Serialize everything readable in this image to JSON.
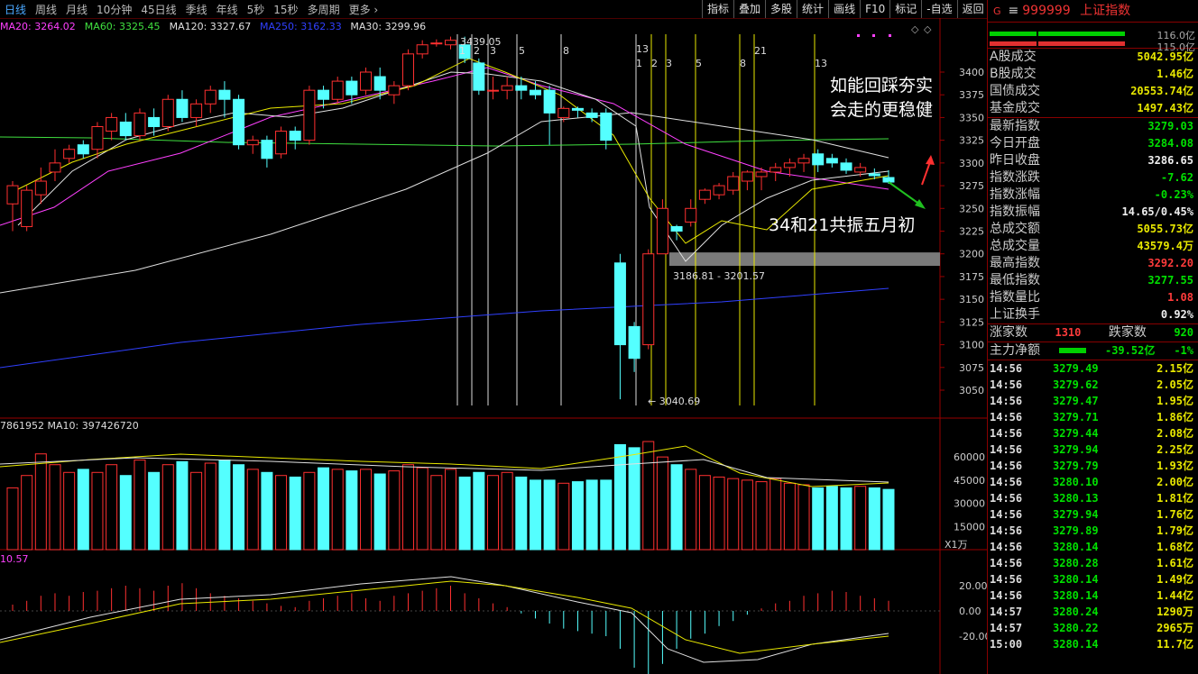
{
  "toolbar": {
    "periods": [
      "日线",
      "周线",
      "月线",
      "10分钟",
      "45日线",
      "季线",
      "年线",
      "5秒",
      "15秒",
      "多周期",
      "更多 ›"
    ],
    "tools": [
      "指标",
      "叠加",
      "多股",
      "统计",
      "画线",
      "F10",
      "标记",
      "-自选",
      "返回"
    ]
  },
  "ma_legend": [
    {
      "label": "MA20: 3264.02",
      "color": "#ff40ff"
    },
    {
      "label": "MA60: 3325.45",
      "color": "#40e040"
    },
    {
      "label": "MA120: 3327.67",
      "color": "#e0e0e0"
    },
    {
      "label": "MA250: 3162.33",
      "color": "#3040ff"
    },
    {
      "label": "MA30: 3299.96",
      "color": "#e0e0e0"
    }
  ],
  "price_axis": [
    "3400",
    "3375",
    "3350",
    "3325",
    "3300",
    "3275",
    "3250",
    "3225",
    "3200",
    "3175",
    "3150",
    "3125",
    "3100",
    "3075",
    "3050"
  ],
  "volume_axis": [
    "60000",
    "45000",
    "30000",
    "15000"
  ],
  "volume_unit": "X1万",
  "macd_axis": [
    "20.00",
    "0.00",
    "-20.00"
  ],
  "volume_legend": "7861952 MA10: 397426720",
  "macd_legend": "10.57",
  "annotations": {
    "high": "3439.05",
    "low": "3040.69",
    "gap_range": "3186.81 - 3201.57",
    "note1_line1": "如能回踩夯实",
    "note1_line2": "会走的更稳健",
    "note2": "34和21共振五月初",
    "fib_top": [
      "1",
      "2",
      "3",
      "5",
      "8"
    ],
    "fib_mid_top": [
      "13"
    ],
    "fib_mid": [
      "1",
      "2",
      "3",
      "5",
      "8"
    ],
    "fib_label_21": "21",
    "fib_label_13": "13"
  },
  "header": {
    "code": "999999",
    "name": "上证指数",
    "g": "G",
    "menu": "≡"
  },
  "bars_top": {
    "up": "116.0亿",
    "down": "115.0亿"
  },
  "stats": [
    {
      "label": "A股成交",
      "value": "5042.95亿",
      "color": "y"
    },
    {
      "label": "B股成交",
      "value": "1.46亿",
      "color": "y"
    },
    {
      "label": "国债成交",
      "value": "20553.74亿",
      "color": "y"
    },
    {
      "label": "基金成交",
      "value": "1497.43亿",
      "color": "y"
    }
  ],
  "stats2": [
    {
      "label": "最新指数",
      "value": "3279.03",
      "color": "gr"
    },
    {
      "label": "今日开盘",
      "value": "3284.08",
      "color": "gr"
    },
    {
      "label": "昨日收盘",
      "value": "3286.65",
      "color": "w"
    },
    {
      "label": "指数涨跌",
      "value": "-7.62",
      "color": "gr"
    },
    {
      "label": "指数涨幅",
      "value": "-0.23%",
      "color": "gr"
    },
    {
      "label": "指数振幅",
      "value": "14.65/0.45%",
      "color": "w"
    },
    {
      "label": "总成交额",
      "value": "5055.73亿",
      "color": "y"
    },
    {
      "label": "总成交量",
      "value": "43579.4万",
      "color": "y"
    },
    {
      "label": "最高指数",
      "value": "3292.20",
      "color": "r"
    },
    {
      "label": "最低指数",
      "value": "3277.55",
      "color": "gr"
    },
    {
      "label": "指数量比",
      "value": "1.08",
      "color": "r"
    },
    {
      "label": "上证换手",
      "value": "0.92%",
      "color": "w"
    }
  ],
  "updown": {
    "up_label": "涨家数",
    "up": "1310",
    "down_label": "跌家数",
    "down": "920"
  },
  "mainflow": {
    "label": "主力净额",
    "value": "-39.52亿",
    "pct": "-1%"
  },
  "ticks": [
    {
      "t": "14:56",
      "p": "3279.49",
      "v": "2.15亿"
    },
    {
      "t": "14:56",
      "p": "3279.62",
      "v": "2.05亿"
    },
    {
      "t": "14:56",
      "p": "3279.47",
      "v": "1.95亿"
    },
    {
      "t": "14:56",
      "p": "3279.71",
      "v": "1.86亿"
    },
    {
      "t": "14:56",
      "p": "3279.44",
      "v": "2.08亿"
    },
    {
      "t": "14:56",
      "p": "3279.94",
      "v": "2.25亿"
    },
    {
      "t": "14:56",
      "p": "3279.79",
      "v": "1.93亿"
    },
    {
      "t": "14:56",
      "p": "3280.10",
      "v": "2.00亿"
    },
    {
      "t": "14:56",
      "p": "3280.13",
      "v": "1.81亿"
    },
    {
      "t": "14:56",
      "p": "3279.94",
      "v": "1.76亿"
    },
    {
      "t": "14:56",
      "p": "3279.89",
      "v": "1.79亿"
    },
    {
      "t": "14:56",
      "p": "3280.14",
      "v": "1.68亿"
    },
    {
      "t": "14:56",
      "p": "3280.28",
      "v": "1.61亿"
    },
    {
      "t": "14:56",
      "p": "3280.14",
      "v": "1.49亿"
    },
    {
      "t": "14:56",
      "p": "3280.14",
      "v": "1.44亿"
    },
    {
      "t": "14:57",
      "p": "3280.24",
      "v": "1290万"
    },
    {
      "t": "14:57",
      "p": "3280.22",
      "v": "2965万"
    },
    {
      "t": "15:00",
      "p": "3280.14",
      "v": "11.7亿"
    }
  ],
  "chart_data": {
    "type": "candlestick",
    "y_range": [
      3040,
      3440
    ],
    "candles": [
      [
        3255,
        3275,
        3225,
        3280
      ],
      [
        3230,
        3270,
        3225,
        3275
      ],
      [
        3265,
        3280,
        3255,
        3295
      ],
      [
        3290,
        3300,
        3280,
        3315
      ],
      [
        3305,
        3315,
        3300,
        3320
      ],
      [
        3320,
        3310,
        3305,
        3325
      ],
      [
        3315,
        3340,
        3305,
        3345
      ],
      [
        3335,
        3350,
        3325,
        3355
      ],
      [
        3345,
        3330,
        3325,
        3355
      ],
      [
        3330,
        3355,
        3325,
        3360
      ],
      [
        3350,
        3340,
        3330,
        3360
      ],
      [
        3340,
        3370,
        3335,
        3375
      ],
      [
        3370,
        3350,
        3345,
        3380
      ],
      [
        3350,
        3365,
        3340,
        3370
      ],
      [
        3365,
        3380,
        3355,
        3385
      ],
      [
        3380,
        3370,
        3350,
        3390
      ],
      [
        3370,
        3320,
        3315,
        3375
      ],
      [
        3320,
        3325,
        3310,
        3330
      ],
      [
        3325,
        3305,
        3295,
        3330
      ],
      [
        3310,
        3335,
        3305,
        3340
      ],
      [
        3335,
        3325,
        3315,
        3340
      ],
      [
        3325,
        3380,
        3320,
        3385
      ],
      [
        3380,
        3370,
        3360,
        3385
      ],
      [
        3370,
        3390,
        3365,
        3395
      ],
      [
        3390,
        3375,
        3365,
        3395
      ],
      [
        3380,
        3400,
        3375,
        3405
      ],
      [
        3395,
        3380,
        3370,
        3405
      ],
      [
        3375,
        3385,
        3365,
        3390
      ],
      [
        3385,
        3420,
        3380,
        3425
      ],
      [
        3420,
        3430,
        3415,
        3435
      ],
      [
        3432,
        3432,
        3428,
        3436
      ],
      [
        3430,
        3435,
        3425,
        3439
      ],
      [
        3430,
        3415,
        3410,
        3439
      ],
      [
        3410,
        3380,
        3375,
        3415
      ],
      [
        3380,
        3380,
        3370,
        3395
      ],
      [
        3380,
        3385,
        3370,
        3395
      ],
      [
        3385,
        3380,
        3370,
        3395
      ],
      [
        3380,
        3375,
        3370,
        3390
      ],
      [
        3380,
        3355,
        3320,
        3385
      ],
      [
        3350,
        3360,
        3345,
        3362
      ],
      [
        3360,
        3358,
        3350,
        3362
      ],
      [
        3355,
        3350,
        3345,
        3360
      ],
      [
        3355,
        3325,
        3315,
        3360
      ],
      [
        3190,
        3100,
        3040,
        3200
      ],
      [
        3120,
        3085,
        3070,
        3125
      ],
      [
        3100,
        3200,
        3095,
        3205
      ],
      [
        3200,
        3250,
        3200,
        3260
      ],
      [
        3230,
        3225,
        3215,
        3232
      ],
      [
        3235,
        3250,
        3230,
        3260
      ],
      [
        3260,
        3270,
        3255,
        3272
      ],
      [
        3265,
        3275,
        3260,
        3278
      ],
      [
        3270,
        3285,
        3265,
        3290
      ],
      [
        3280,
        3290,
        3270,
        3292
      ],
      [
        3285,
        3290,
        3270,
        3295
      ],
      [
        3290,
        3295,
        3280,
        3300
      ],
      [
        3295,
        3300,
        3285,
        3305
      ],
      [
        3300,
        3305,
        3290,
        3310
      ],
      [
        3310,
        3298,
        3290,
        3315
      ],
      [
        3305,
        3300,
        3295,
        3310
      ],
      [
        3300,
        3292,
        3288,
        3305
      ],
      [
        3290,
        3295,
        3285,
        3300
      ],
      [
        3288,
        3286,
        3282,
        3294
      ],
      [
        3284,
        3279,
        3277,
        3292
      ]
    ],
    "volumes": [
      40,
      48,
      62,
      55,
      50,
      52,
      50,
      55,
      48,
      58,
      50,
      55,
      57,
      50,
      56,
      58,
      55,
      52,
      50,
      48,
      47,
      50,
      53,
      52,
      51,
      52,
      49,
      51,
      55,
      53,
      48,
      52,
      47,
      50,
      48,
      50,
      47,
      45,
      45,
      43,
      44,
      45,
      45,
      68,
      66,
      70,
      60,
      55,
      52,
      48,
      47,
      46,
      45,
      44,
      46,
      43,
      42,
      40,
      41,
      40,
      41,
      40,
      39
    ]
  }
}
